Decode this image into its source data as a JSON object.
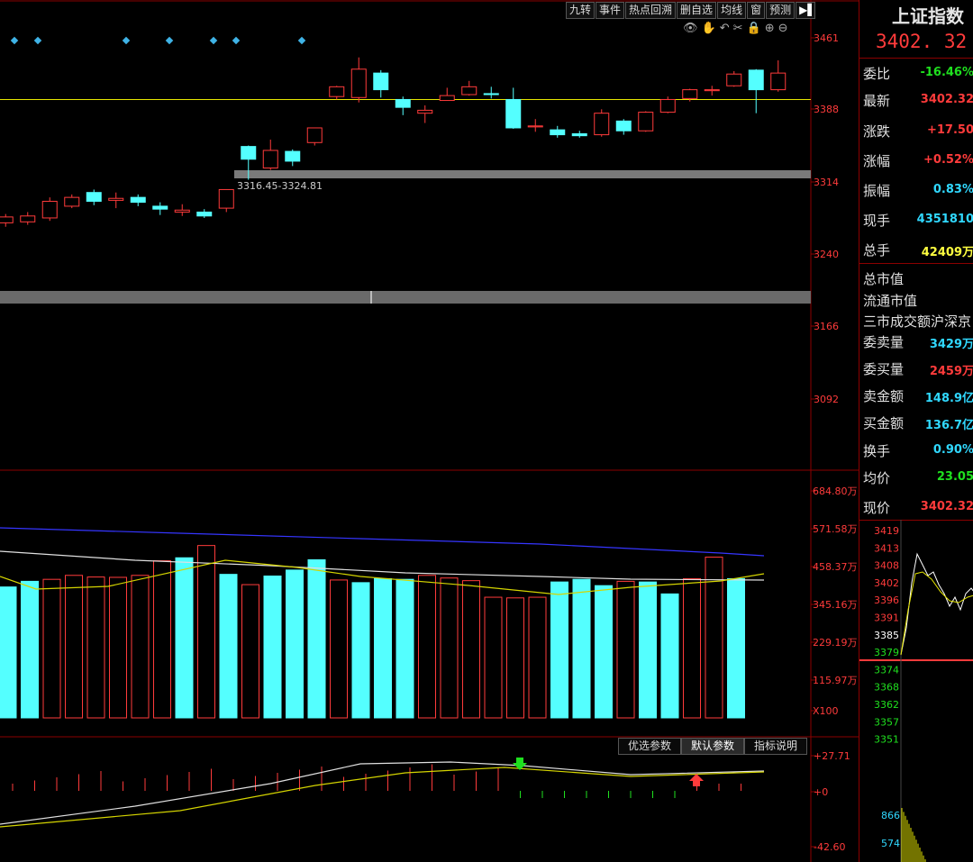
{
  "toolbar": {
    "items": [
      "九转",
      "事件",
      "热点回溯",
      "删自选",
      "均线",
      "窗",
      "预测"
    ],
    "arrow": "▶▌"
  },
  "chart_tools_icons": [
    "eye-icon",
    "hand-icon",
    "undo-icon",
    "scissors-icon",
    "lock-icon",
    "zoom-in-icon",
    "zoom-out-icon"
  ],
  "price_panel": {
    "axis_labels": [
      "3461",
      "3388",
      "3314",
      "3240",
      "3166",
      "3092"
    ],
    "range_label": "3316.45-3324.81",
    "horizontal_line": 3398,
    "candles": [
      {
        "o": 3272,
        "c": 3278,
        "h": 3281,
        "l": 3268
      },
      {
        "o": 3273,
        "c": 3279,
        "h": 3283,
        "l": 3270
      },
      {
        "o": 3277,
        "c": 3294,
        "h": 3298,
        "l": 3274
      },
      {
        "o": 3289,
        "c": 3298,
        "h": 3301,
        "l": 3287
      },
      {
        "o": 3303,
        "c": 3294,
        "h": 3306,
        "l": 3290
      },
      {
        "o": 3295,
        "c": 3297,
        "h": 3303,
        "l": 3287
      },
      {
        "o": 3298,
        "c": 3293,
        "h": 3301,
        "l": 3289
      },
      {
        "o": 3289,
        "c": 3286,
        "h": 3293,
        "l": 3280
      },
      {
        "o": 3283,
        "c": 3285,
        "h": 3291,
        "l": 3279
      },
      {
        "o": 3283,
        "c": 3279,
        "h": 3286,
        "l": 3277
      },
      {
        "o": 3287,
        "c": 3306,
        "h": 3306,
        "l": 3283
      },
      {
        "o": 3350,
        "c": 3337,
        "h": 3351,
        "l": 3316
      },
      {
        "o": 3328,
        "c": 3346,
        "h": 3357,
        "l": 3326
      },
      {
        "o": 3345,
        "c": 3335,
        "h": 3347,
        "l": 3330
      },
      {
        "o": 3354,
        "c": 3369,
        "h": 3369,
        "l": 3351
      },
      {
        "o": 3401,
        "c": 3411,
        "h": 3412,
        "l": 3398
      },
      {
        "o": 3400,
        "c": 3429,
        "h": 3441,
        "l": 3395
      },
      {
        "o": 3425,
        "c": 3408,
        "h": 3428,
        "l": 3400
      },
      {
        "o": 3398,
        "c": 3390,
        "h": 3401,
        "l": 3382
      },
      {
        "o": 3384,
        "c": 3387,
        "h": 3392,
        "l": 3374
      },
      {
        "o": 3397,
        "c": 3402,
        "h": 3410,
        "l": 3397
      },
      {
        "o": 3403,
        "c": 3411,
        "h": 3417,
        "l": 3402
      },
      {
        "o": 3404,
        "c": 3403,
        "h": 3411,
        "l": 3399
      },
      {
        "o": 3398,
        "c": 3369,
        "h": 3410,
        "l": 3368
      },
      {
        "o": 3370,
        "c": 3371,
        "h": 3378,
        "l": 3365
      },
      {
        "o": 3367,
        "c": 3362,
        "h": 3371,
        "l": 3359
      },
      {
        "o": 3363,
        "c": 3361,
        "h": 3366,
        "l": 3359
      },
      {
        "o": 3362,
        "c": 3384,
        "h": 3388,
        "l": 3360
      },
      {
        "o": 3376,
        "c": 3366,
        "h": 3378,
        "l": 3362
      },
      {
        "o": 3366,
        "c": 3385,
        "h": 3386,
        "l": 3365
      },
      {
        "o": 3385,
        "c": 3398,
        "h": 3401,
        "l": 3384
      },
      {
        "o": 3399,
        "c": 3408,
        "h": 3409,
        "l": 3396
      },
      {
        "o": 3407,
        "c": 3408,
        "h": 3412,
        "l": 3402
      },
      {
        "o": 3412,
        "c": 3424,
        "h": 3427,
        "l": 3411
      },
      {
        "o": 3428,
        "c": 3408,
        "h": 3429,
        "l": 3384
      },
      {
        "o": 3408,
        "c": 3425,
        "h": 3438,
        "l": 3406
      }
    ],
    "markers_count": 7
  },
  "volume_panel": {
    "axis_labels": [
      "684.80万",
      "571.58万",
      "458.37万",
      "345.16万",
      "229.19万",
      "115.97万",
      "X100"
    ],
    "bars": [
      {
        "v": 395,
        "up": true
      },
      {
        "v": 412,
        "up": true
      },
      {
        "v": 418,
        "up": false
      },
      {
        "v": 430,
        "up": false
      },
      {
        "v": 425,
        "up": false
      },
      {
        "v": 424,
        "up": false
      },
      {
        "v": 430,
        "up": false
      },
      {
        "v": 474,
        "up": false
      },
      {
        "v": 483,
        "up": true
      },
      {
        "v": 520,
        "up": false
      },
      {
        "v": 433,
        "up": true
      },
      {
        "v": 402,
        "up": false
      },
      {
        "v": 428,
        "up": true
      },
      {
        "v": 446,
        "up": true
      },
      {
        "v": 477,
        "up": true
      },
      {
        "v": 416,
        "up": false
      },
      {
        "v": 408,
        "up": true
      },
      {
        "v": 420,
        "up": true
      },
      {
        "v": 418,
        "up": true
      },
      {
        "v": 430,
        "up": false
      },
      {
        "v": 422,
        "up": false
      },
      {
        "v": 414,
        "up": false
      },
      {
        "v": 364,
        "up": false
      },
      {
        "v": 362,
        "up": false
      },
      {
        "v": 364,
        "up": false
      },
      {
        "v": 410,
        "up": true
      },
      {
        "v": 418,
        "up": true
      },
      {
        "v": 399,
        "up": true
      },
      {
        "v": 412,
        "up": false
      },
      {
        "v": 410,
        "up": true
      },
      {
        "v": 374,
        "up": true
      },
      {
        "v": 420,
        "up": false
      },
      {
        "v": 485,
        "up": false
      },
      {
        "v": 420,
        "up": true
      }
    ]
  },
  "indicator_panel": {
    "tabs": [
      "优选参数",
      "默认参数",
      "指标说明"
    ],
    "active_tab": 1,
    "axis_labels": [
      "+27.71",
      "+0",
      "-42.60"
    ]
  },
  "quote": {
    "title": "上证指数",
    "price": "3402. 32",
    "rows": [
      {
        "label": "委比",
        "value": "-16.46%",
        "color": "green"
      },
      {
        "label": "最新",
        "value": "3402.32",
        "color": "red"
      },
      {
        "label": "涨跌",
        "value": "+17.50",
        "color": "red"
      },
      {
        "label": "涨幅",
        "value": "+0.52%",
        "color": "red"
      },
      {
        "label": "振幅",
        "value": "0.83%",
        "color": "cyan"
      },
      {
        "label": "现手",
        "value": "4351810",
        "color": "cyan"
      },
      {
        "label": "总手",
        "value": "42409万",
        "color": "yellow"
      },
      {
        "label": "总市值",
        "value": "",
        "color": ""
      },
      {
        "label": "流通市值",
        "value": "",
        "color": ""
      },
      {
        "label": "三市成交额沪深京",
        "value": "",
        "color": ""
      },
      {
        "label": "委卖量",
        "value": "3429万",
        "color": "cyan"
      },
      {
        "label": "委买量",
        "value": "2459万",
        "color": "red"
      },
      {
        "label": "卖金额",
        "value": "148.9亿",
        "color": "cyan"
      },
      {
        "label": "买金额",
        "value": "136.7亿",
        "color": "cyan"
      },
      {
        "label": "换手",
        "value": "0.90%",
        "color": "cyan"
      },
      {
        "label": "均价",
        "value": "23.05",
        "color": "green"
      },
      {
        "label": "现价",
        "value": "3402.32",
        "color": "red"
      }
    ],
    "intraday_axis": [
      "3419",
      "3413",
      "3408",
      "3402",
      "3396",
      "3391",
      "3385",
      "3379",
      "3374",
      "3368",
      "3362",
      "3357",
      "3351"
    ],
    "intraday_volume_axis": [
      "866",
      "574"
    ]
  }
}
